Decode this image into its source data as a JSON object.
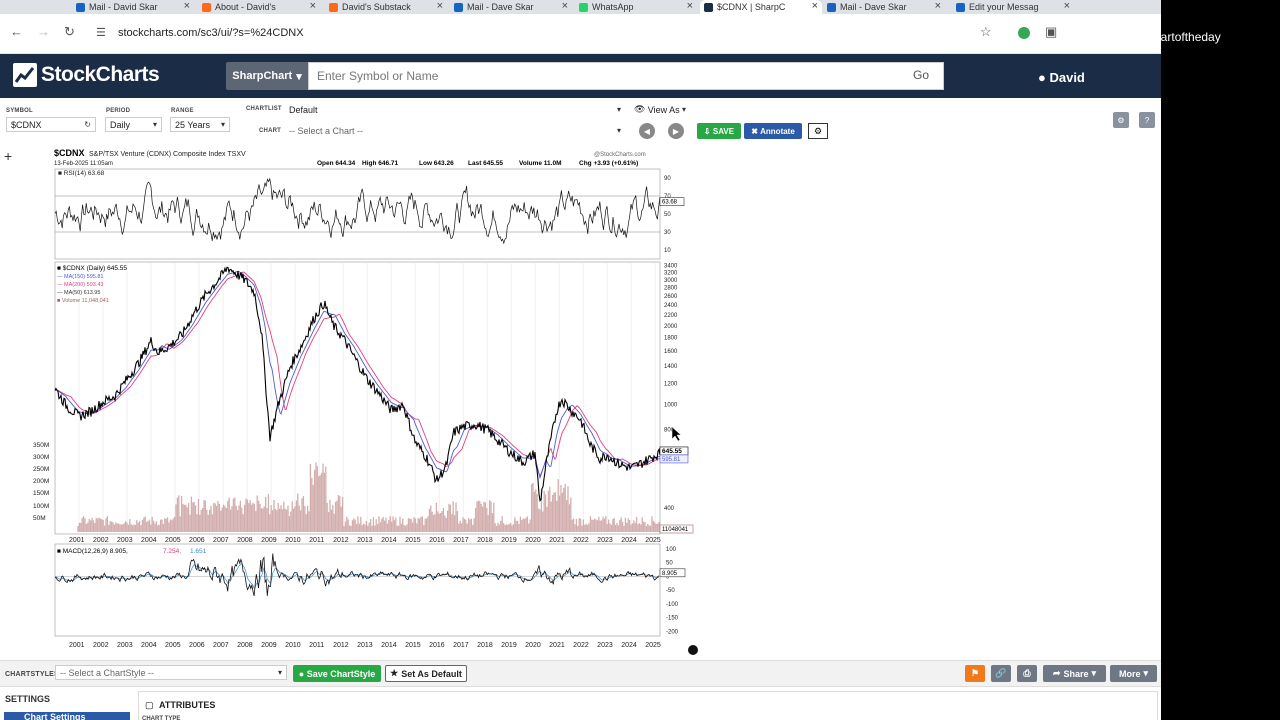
{
  "tabs": [
    {
      "title": "Mail - David Skar",
      "color": "#1565c0"
    },
    {
      "title": "About - David's",
      "color": "#ff6719"
    },
    {
      "title": "David's Substack",
      "color": "#ff6719"
    },
    {
      "title": "Mail - Dave Skar",
      "color": "#1565c0"
    },
    {
      "title": "WhatsApp",
      "color": "#25d366"
    },
    {
      "title": "$CDNX | SharpC",
      "color": "#1b2c47"
    },
    {
      "title": "Mail - Dave Skar",
      "color": "#1565c0"
    },
    {
      "title": "Edit your Messag",
      "color": "#1565c0"
    }
  ],
  "address": {
    "url": "stockcharts.com/sc3/ui/?s=%24CDNX"
  },
  "header": {
    "logo": "StockCharts",
    "product_dropdown": "SharpChart",
    "search_placeholder": "Enter Symbol or Name",
    "go_label": "Go",
    "user": "David"
  },
  "toolbar": {
    "symbol_label": "SYMBOL",
    "symbol_value": "$CDNX",
    "period_label": "PERIOD",
    "period_value": "Daily",
    "range_label": "RANGE",
    "range_value": "25 Years",
    "chartlist_label": "CHARTLIST",
    "chartlist_value": "Default",
    "chart_label": "CHART",
    "chart_value": "-- Select a Chart --",
    "view_as": "View As",
    "save": "SAVE",
    "annotate": "Annotate"
  },
  "chart_header": {
    "symbol": "$CDNX",
    "name": "S&P/TSX Venture (CDNX) Composite Index  TSXV",
    "watermark": "@StockCharts.com",
    "date": "13-Feb-2025 11:05am",
    "open": "Open 644.34",
    "high": "High 646.71",
    "low": "Low 643.26",
    "last": "Last 645.55",
    "volume": "Volume 11.0M",
    "chg": "Chg +3.93 (+0.61%)"
  },
  "legends": {
    "rsi": "RSI(14) 63.68",
    "price": "$CDNX (Daily) 645.55",
    "ma150": "MA(150) 595.81",
    "ma200": "MA(200) 593.43",
    "ma50": "MA(50) 613.95",
    "volume": "Volume 11,048,041",
    "macd_main": "MACD(12,26,9) 8.905,",
    "macd_sig": "7.254,",
    "macd_hist": "1.651"
  },
  "badges": {
    "rsi": "63.68",
    "price": "645.55",
    "ma": "595.81",
    "volume": "11048041",
    "macd": "8.905"
  },
  "chart_data": {
    "type": "line",
    "title": "$CDNX S&P/TSX Venture (CDNX) Composite Index",
    "panels": {
      "rsi": {
        "label": "RSI(14)",
        "last": 63.68,
        "ticks": [
          90,
          70,
          50,
          30,
          10
        ]
      },
      "price": {
        "label": "$CDNX (Daily)",
        "scale": "log",
        "ticks": [
          3400,
          3200,
          3000,
          2800,
          2600,
          2400,
          2200,
          2000,
          1800,
          1600,
          1400,
          1200,
          1000,
          800,
          400
        ],
        "volume_ticks": [
          "350M",
          "300M",
          "250M",
          "200M",
          "150M",
          "100M",
          "50M"
        ],
        "x": [
          2000.0,
          2000.5,
          2001.0,
          2001.5,
          2002.0,
          2002.5,
          2003.0,
          2003.5,
          2004.0,
          2004.3,
          2004.8,
          2005.3,
          2005.8,
          2006.3,
          2006.8,
          2007.2,
          2007.5,
          2007.9,
          2008.3,
          2008.6,
          2008.95,
          2009.3,
          2009.8,
          2010.3,
          2010.8,
          2011.2,
          2011.6,
          2012.0,
          2012.5,
          2013.0,
          2013.5,
          2014.0,
          2014.5,
          2015.0,
          2015.5,
          2015.9,
          2016.3,
          2016.6,
          2017.0,
          2017.5,
          2018.0,
          2018.5,
          2019.0,
          2019.5,
          2020.0,
          2020.2,
          2020.5,
          2020.9,
          2021.1,
          2021.5,
          2021.9,
          2022.3,
          2022.7,
          2023.0,
          2023.5,
          2024.0,
          2024.5,
          2025.1
        ],
        "values": [
          1150,
          980,
          900,
          940,
          1020,
          1080,
          1250,
          1450,
          1750,
          1580,
          1680,
          1850,
          2250,
          2650,
          3000,
          3350,
          3200,
          3000,
          2700,
          1900,
          750,
          1000,
          1400,
          1700,
          2150,
          2450,
          2000,
          1800,
          1500,
          1250,
          1100,
          950,
          1000,
          720,
          620,
          510,
          580,
          780,
          820,
          840,
          800,
          720,
          650,
          600,
          650,
          420,
          620,
          950,
          1050,
          950,
          870,
          700,
          620,
          640,
          590,
          570,
          600,
          645.55
        ]
      },
      "macd": {
        "label": "MACD(12,26,9)",
        "last": 8.905,
        "ticks": [
          100,
          50,
          0,
          -50,
          -100,
          -150,
          -200
        ]
      }
    },
    "x_axis_labels": [
      "2001",
      "2002",
      "2003",
      "2004",
      "2005",
      "2006",
      "2007",
      "2008",
      "2009",
      "2010",
      "2011",
      "2012",
      "2013",
      "2014",
      "2015",
      "2016",
      "2017",
      "2018",
      "2019",
      "2020",
      "2021",
      "2022",
      "2023",
      "2024",
      "2025"
    ]
  },
  "bottom": {
    "chartstyles_label": "CHARTSTYLES",
    "chartstyle_select": "-- Select a ChartStyle --",
    "save_chartstyle": "Save ChartStyle",
    "set_default": "Set As Default",
    "share": "Share",
    "more": "More",
    "settings_label": "SETTINGS",
    "chart_settings": "Chart Settings",
    "attributes": "ATTRIBUTES",
    "chart_type": "CHART TYPE"
  },
  "overlay": {
    "label": "Stockchartoftheday"
  }
}
